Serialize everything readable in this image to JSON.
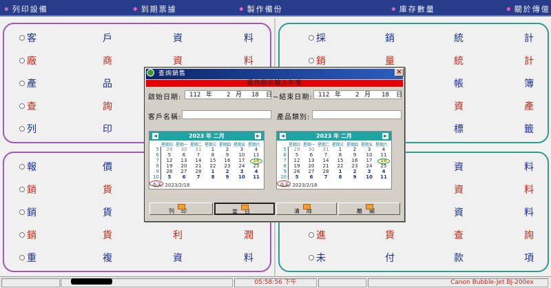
{
  "menu": [
    "列印設備",
    "到期票據",
    "製作備份",
    "庫存數量",
    "關於傳億"
  ],
  "panels": {
    "tl": [
      {
        "c": [
          "客",
          "戶",
          "資",
          "料"
        ],
        "color": "blue"
      },
      {
        "c": [
          "廠",
          "商",
          "資",
          "料"
        ],
        "color": "red"
      },
      {
        "c": [
          "產",
          "品",
          "",
          ""
        ],
        "color": "blue"
      },
      {
        "c": [
          "查",
          "詢",
          "",
          ""
        ],
        "color": "red"
      },
      {
        "c": [
          "列",
          "印",
          "",
          ""
        ],
        "color": "blue"
      }
    ],
    "tr": [
      {
        "c": [
          "採",
          "銷",
          "統",
          "計"
        ],
        "color": "blue"
      },
      {
        "c": [
          "銷",
          "量",
          "統",
          "計"
        ],
        "color": "red"
      },
      {
        "c": [
          "",
          "",
          "帳",
          "簿"
        ],
        "color": "blue"
      },
      {
        "c": [
          "",
          "",
          "資",
          "產"
        ],
        "color": "red"
      },
      {
        "c": [
          "",
          "",
          "標",
          "籤"
        ],
        "color": "blue"
      }
    ],
    "bl": [
      {
        "c": [
          "報",
          "價",
          "",
          ""
        ],
        "color": "blue"
      },
      {
        "c": [
          "銷",
          "貨",
          "",
          ""
        ],
        "color": "red"
      },
      {
        "c": [
          "銷",
          "貨",
          "",
          ""
        ],
        "color": "blue"
      },
      {
        "c": [
          "銷",
          "貨",
          "利",
          "潤"
        ],
        "color": "red"
      },
      {
        "c": [
          "重",
          "複",
          "資",
          "料"
        ],
        "color": "blue"
      }
    ],
    "br": [
      {
        "c": [
          "",
          "",
          "資",
          "料"
        ],
        "color": "blue"
      },
      {
        "c": [
          "",
          "",
          "資",
          "料"
        ],
        "color": "red"
      },
      {
        "c": [
          "",
          "",
          "資",
          "料"
        ],
        "color": "blue"
      },
      {
        "c": [
          "進",
          "貨",
          "查",
          "詢"
        ],
        "color": "red"
      },
      {
        "c": [
          "未",
          "付",
          "款",
          "項"
        ],
        "color": "blue"
      }
    ]
  },
  "dialog": {
    "title": "查詢銷售",
    "banner": "操作指示輸入年度",
    "start_label": "啟始日期:",
    "end_label": "~結束日期:",
    "start": {
      "y": "112",
      "yu": "年",
      "m": "2",
      "mu": "月",
      "d": "18",
      "du": "日"
    },
    "end": {
      "y": "112",
      "yu": "年",
      "m": "2",
      "mu": "月",
      "d": "18",
      "du": "日"
    },
    "customer_label": "客戶名稱:",
    "category_label": "產品類別:",
    "buttons": [
      "列印",
      "當日",
      "清除",
      "離開"
    ]
  },
  "calendar": {
    "header": "2023 年 二月",
    "dow": [
      "星期日",
      "星期一",
      "星期二",
      "星期三",
      "星期四",
      "星期五",
      "星期六"
    ],
    "weeks": [
      "5",
      "6",
      "7",
      "8",
      "9",
      "10"
    ],
    "days": [
      [
        "29",
        "30",
        "31",
        "1",
        "2",
        "3",
        "4"
      ],
      [
        "5",
        "6",
        "7",
        "8",
        "9",
        "10",
        "11"
      ],
      [
        "12",
        "13",
        "14",
        "15",
        "16",
        "17",
        "18"
      ],
      [
        "19",
        "20",
        "21",
        "22",
        "23",
        "24",
        "25"
      ],
      [
        "26",
        "27",
        "28",
        "1",
        "2",
        "3",
        "4"
      ],
      [
        "5",
        "6",
        "7",
        "8",
        "9",
        "10",
        "11"
      ]
    ],
    "today": "今天: 2023/2/18"
  },
  "status": {
    "time": "05:58:56 下午",
    "printer": "Canon Bubble-Jet BJ-200ex"
  }
}
